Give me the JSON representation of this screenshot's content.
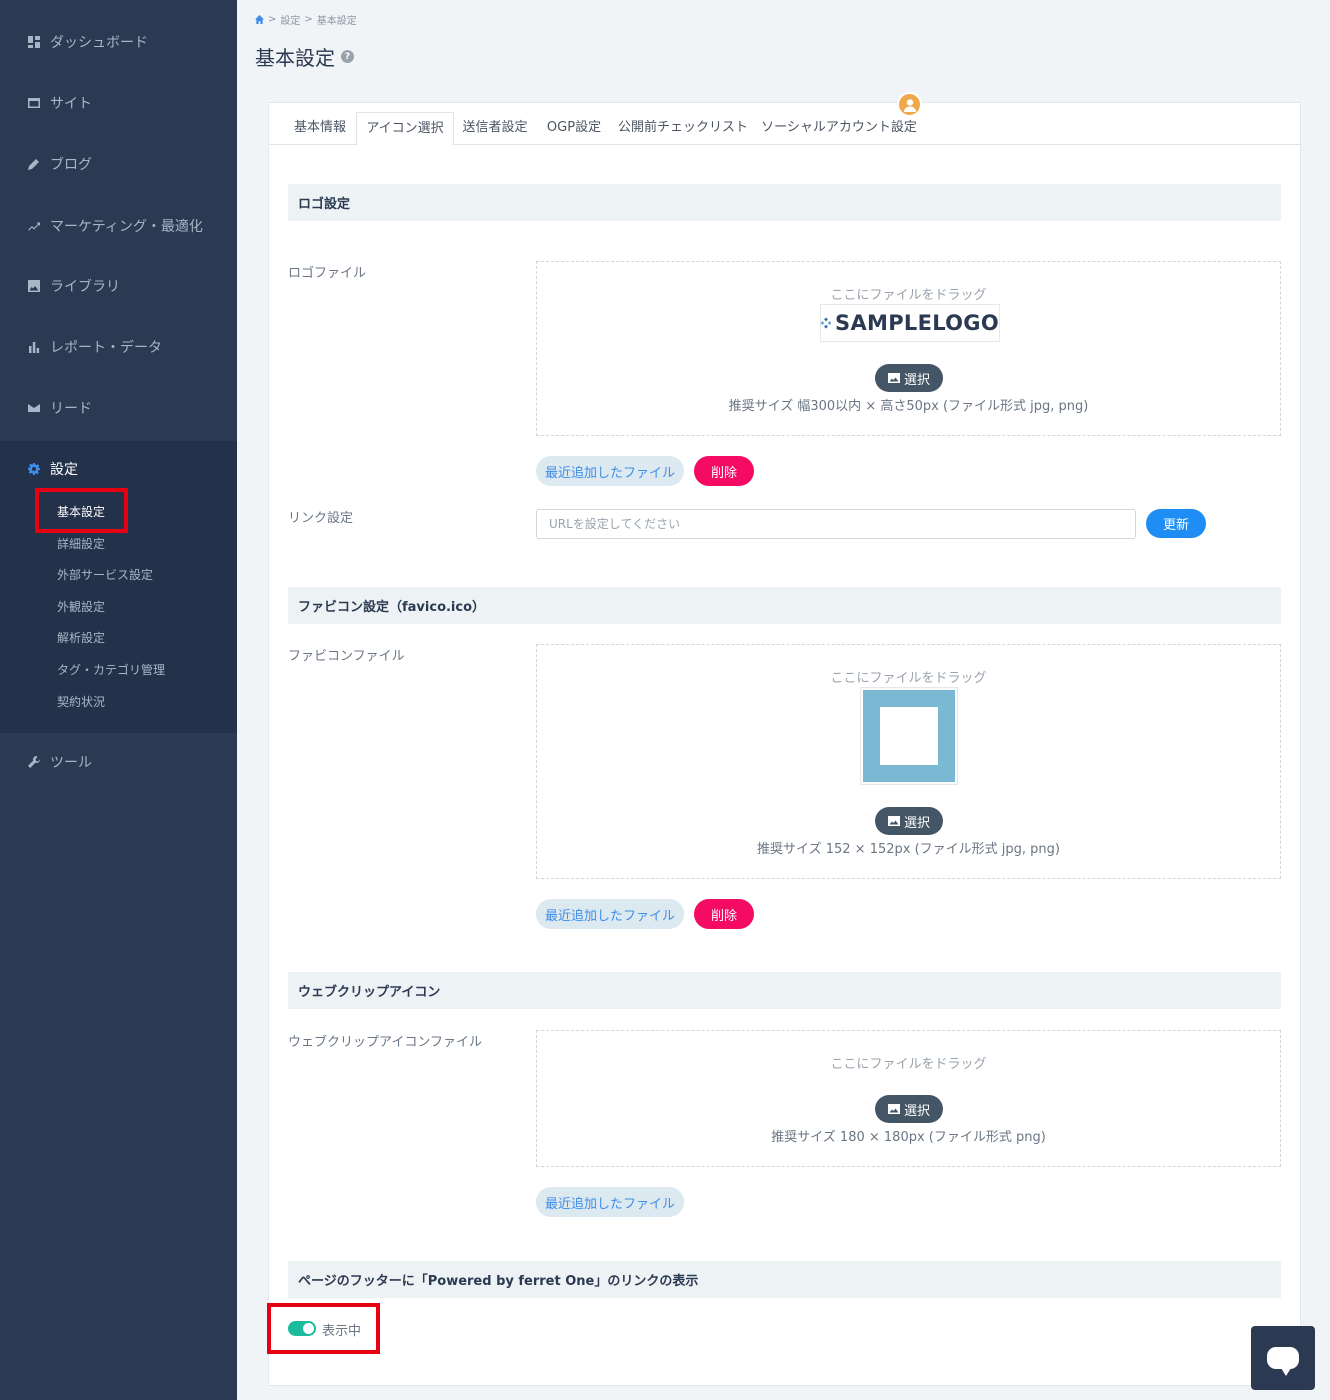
{
  "sidebar": {
    "items": [
      {
        "label": "ダッシュボード",
        "icon": "dashboard-icon"
      },
      {
        "label": "サイト",
        "icon": "site-icon"
      },
      {
        "label": "ブログ",
        "icon": "pencil-icon"
      },
      {
        "label": "マーケティング・最適化",
        "icon": "trend-icon"
      },
      {
        "label": "ライブラリ",
        "icon": "image-icon"
      },
      {
        "label": "レポート・データ",
        "icon": "bar-chart-icon"
      },
      {
        "label": "リード",
        "icon": "mail-icon"
      },
      {
        "label": "設定",
        "icon": "gear-icon"
      },
      {
        "label": "ツール",
        "icon": "wrench-icon"
      }
    ],
    "settings_sub": [
      "基本設定",
      "詳細設定",
      "外部サービス設定",
      "外観設定",
      "解析設定",
      "タグ・カテゴリ管理",
      "契約状況"
    ]
  },
  "breadcrumb": {
    "sep": ">",
    "level1": "設定",
    "level2": "基本設定"
  },
  "page_title": "基本設定",
  "help_mark": "?",
  "tabs": [
    "基本情報",
    "アイコン選択",
    "送信者設定",
    "OGP設定",
    "公開前チェックリスト",
    "ソーシャルアカウント設定"
  ],
  "logo_section": {
    "title": "ロゴ設定",
    "file_label": "ロゴファイル",
    "drag_text": "ここにファイルをドラッグ",
    "logo_text": "SAMPLELOGO",
    "select_label": "選択",
    "note": "推奨サイズ 幅300以内 × 高さ50px (ファイル形式 jpg, png)",
    "recent_label": "最近追加したファイル",
    "delete_label": "削除",
    "link_label": "リンク設定",
    "url_placeholder": "URLを設定してください",
    "update_label": "更新"
  },
  "favicon_section": {
    "title": "ファビコン設定（favico.ico）",
    "file_label": "ファビコンファイル",
    "drag_text": "ここにファイルをドラッグ",
    "select_label": "選択",
    "note": "推奨サイズ 152 × 152px (ファイル形式 jpg, png)",
    "recent_label": "最近追加したファイル",
    "delete_label": "削除"
  },
  "webclip_section": {
    "title": "ウェブクリップアイコン",
    "file_label": "ウェブクリップアイコンファイル",
    "drag_text": "ここにファイルをドラッグ",
    "select_label": "選択",
    "note": "推奨サイズ 180 × 180px (ファイル形式 png)",
    "recent_label": "最近追加したファイル"
  },
  "footer_section": {
    "title": "ページのフッターに「Powered by ferret One」のリンクの表示",
    "toggle_label": "表示中",
    "toggle_on": true
  },
  "colors": {
    "sidebar": "#2b3a52",
    "accent_blue": "#1e8ef5",
    "delete_pink": "#f50b63",
    "toggle_green": "#1abc9c",
    "highlight_red": "#e60012"
  }
}
